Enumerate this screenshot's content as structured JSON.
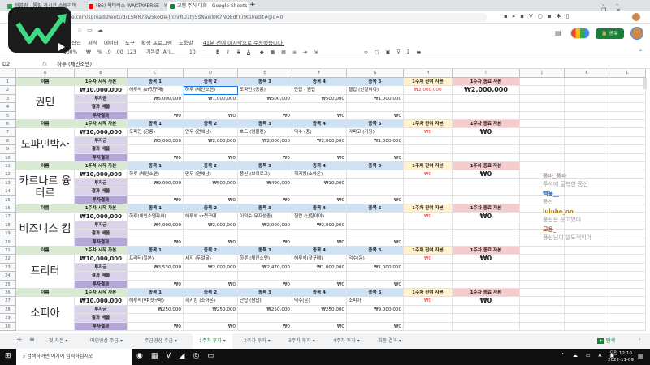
{
  "browser": {
    "tabs": [
      {
        "label": "워블링 - 통합 라시간 스트리머",
        "color": "#2da44e"
      },
      {
        "label": "(86) 왁타버스 WAKTAVERSE - Y",
        "color": "#ff0000"
      },
      {
        "label": "고멤 주식 대회 - Google Sheets",
        "color": "#188038"
      }
    ],
    "url": "e.com/spreadsheets/d/15MR78w5koQe-JrcnrRU1ty5SNawl0K7NQ8dfT7fK1l/edit#gid=0"
  },
  "sheets": {
    "menu": [
      "삽입",
      "서식",
      "데이터",
      "도구",
      "확장 프로그램",
      "도움말"
    ],
    "last_edit": "41분 전에 마지막으로 수정했습니다.",
    "share_label": "공유",
    "toolbar": {
      "zoom": "100%",
      "currency": "₩",
      "percent": "%",
      "dec_less": ".0",
      "dec_more": ".00",
      "format": "123",
      "font": "기본값 (Ari...",
      "size": "10",
      "bold": "B",
      "italic": "I",
      "strike": "S",
      "color": "A"
    },
    "name_box": "D2",
    "formula": "하루 (체인소맨)"
  },
  "columns": [
    "A",
    "B",
    "C",
    "D",
    "E",
    "F",
    "G",
    "H",
    "I",
    "J",
    "K",
    "L"
  ],
  "headers": {
    "name": "이름",
    "start": "1주차 시작 자본",
    "stocks": [
      "종목 1",
      "종목 2",
      "종목 3",
      "종목 4",
      "종목 5"
    ],
    "remain": "1주차 잔여 자본",
    "end": "1주차 종료 자본",
    "invest": "투자금",
    "multiplier": "결과 배율",
    "result": "투자결과"
  },
  "players": [
    {
      "name": "권민",
      "capital": "₩10,000,000",
      "stocks": [
        "해루석 (vr첫구매)",
        "하루 (체인소맨)",
        "도파민 (공룡)",
        "단답 - 짬답",
        "챌캅 (난잘이야)"
      ],
      "invest": [
        "₩5,000,000",
        "₩1,000,000",
        "₩500,000",
        "₩500,000",
        "₩1,000,000"
      ],
      "results": [
        "₩0",
        "₩0",
        "₩0",
        "₩0",
        "₩0"
      ],
      "remain": "₩2,000,000",
      "end": "₩2,000,000"
    },
    {
      "name": "도파민박사",
      "capital": "₩10,000,000",
      "stocks": [
        "도파민 (공룡)",
        "만두 (연해남)",
        "호드 (덤블렌)",
        "덕수 (충)",
        "악파고 (기딩)"
      ],
      "invest": [
        "₩3,000,000",
        "₩2,000,000",
        "₩2,000,000",
        "₩2,000,000",
        "₩1,000,000"
      ],
      "results": [
        "₩0",
        "₩0",
        "₩0",
        "₩0",
        "₩0"
      ],
      "remain": "₩0",
      "end": "₩0"
    },
    {
      "name": "카르나르 융터르",
      "capital": "₩10,000,000",
      "stocks": [
        "하루 (체인소맨)",
        "만두 (연해남)",
        "풍신 (브이로그)",
        "히키킹(소아온)",
        ""
      ],
      "invest": [
        "₩9,000,000",
        "₩500,000",
        "₩490,000",
        "₩10,000",
        ""
      ],
      "results": [
        "₩0",
        "₩0",
        "₩0",
        "₩0",
        "₩0"
      ],
      "remain": "₩0",
      "end": "₩0"
    },
    {
      "name": "비즈니스 킴",
      "capital": "₩10,000,000",
      "stocks": [
        "하루(체인소맨파워)",
        "해루석 vr첫구매",
        "이덕수(무지성즘)",
        "챌캅 (난잘이야)",
        ""
      ],
      "invest": [
        "₩4,000,000",
        "₩2,000,000",
        "₩2,000,000",
        "₩2,000,000",
        ""
      ],
      "results": [
        "₩0",
        "₩0",
        "₩0",
        "₩0",
        "₩0"
      ],
      "remain": "₩0",
      "end": "₩0"
    },
    {
      "name": "프리터",
      "capital": "₩10,000,000",
      "stocks": [
        "프리터(일본)",
        "세지 (두얼굴)",
        "하루 (체인소맨)",
        "해루석(첫구매)",
        "덕수(운)"
      ],
      "invest": [
        "₩3,530,000",
        "₩2,000,000",
        "₩2,470,000",
        "₩1,000,000",
        "₩1,000,000"
      ],
      "results": [
        "₩0",
        "₩0",
        "₩0",
        "₩0",
        "₩0"
      ],
      "remain": "₩0",
      "end": "₩0"
    },
    {
      "name": "소피아",
      "capital": "₩10,000,000",
      "stocks": [
        "해루석(VR첫구매)",
        "히키킹 (소아온)",
        "단답 (짬답)",
        "덕수(운)",
        "소피아"
      ],
      "invest": [
        "₩250,000",
        "₩250,000",
        "₩250,000",
        "₩250,000",
        "₩9,000,000"
      ],
      "results": [
        "₩0",
        "₩0",
        "₩0",
        "₩0",
        "₩0"
      ],
      "remain": "₩0",
      "end": "₩0"
    }
  ],
  "chat": [
    {
      "user": "풍파_풍파",
      "msg": "투석에 굴복한 풍신",
      "color": "#b0a0a0"
    },
    {
      "user": "백용__",
      "msg": "풍신",
      "color": "#1565c0"
    },
    {
      "user": "lulube_on",
      "msg": "풍신은 웃고있다",
      "color": "#b8860b"
    },
    {
      "user": "모옹_",
      "msg": "풍신님이 알도적이야",
      "color": "#a0522d"
    }
  ],
  "sheet_tabs": [
    "첫 자본",
    "메인영상 주급",
    "주급영상 주급",
    "1주차 투자",
    "2주차 투자",
    "3주차 투자",
    "4주차 투자",
    "최종 결과"
  ],
  "active_tab": 3,
  "explore_label": "탐색",
  "taskbar": {
    "search": "검색하려면 여기에 입력하십시오",
    "time": "오전 12:10",
    "date": "2022-11-09"
  },
  "colors": {
    "name_hdr": "#d9ead3",
    "stock_hdr": "#cfe2f3",
    "remain_hdr": "#fff2cc",
    "end_hdr": "#f4cccc",
    "label": "#d9d2e9",
    "result_label": "#b4a7d6",
    "red": "#e53935"
  }
}
